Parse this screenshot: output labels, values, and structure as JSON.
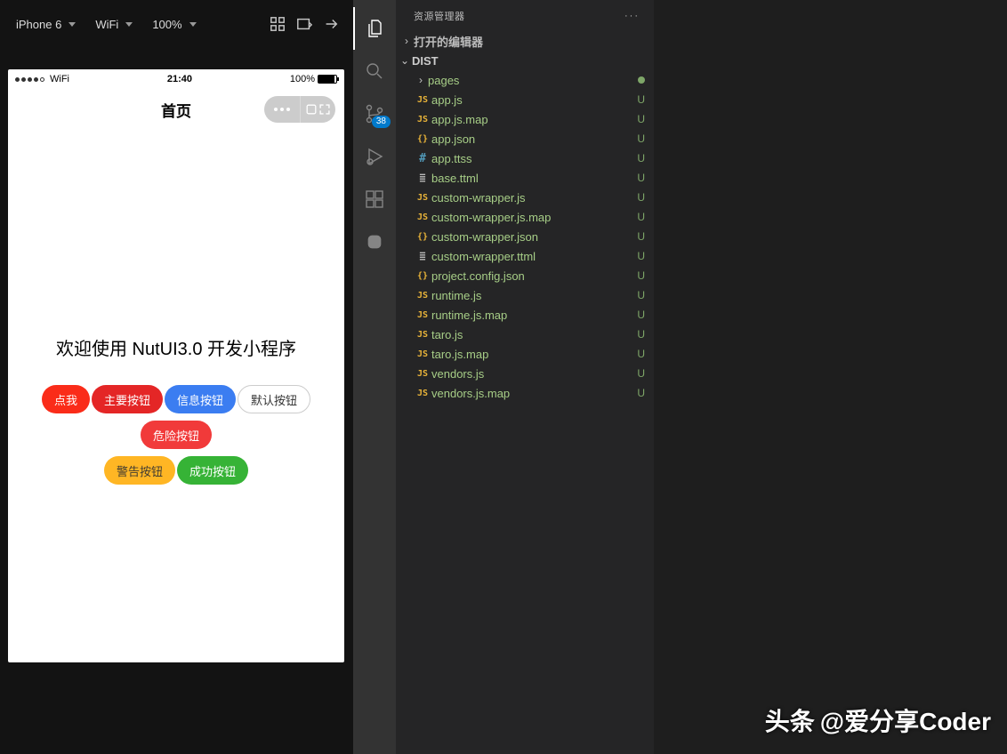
{
  "simulator": {
    "top_menu": [
      "",
      "",
      "",
      "",
      "",
      ""
    ],
    "toolbar": {
      "device": "iPhone 6",
      "network": "WiFi",
      "scale": "100%"
    },
    "status": {
      "carrier": "WiFi",
      "time": "21:40",
      "battery": "100%"
    },
    "nav_title": "首页",
    "welcome": "欢迎使用 NutUI3.0 开发小程序",
    "buttons": [
      {
        "label": "点我",
        "cls": "b1"
      },
      {
        "label": "主要按钮",
        "cls": "b2"
      },
      {
        "label": "信息按钮",
        "cls": "b3"
      },
      {
        "label": "默认按钮",
        "cls": "b4"
      },
      {
        "label": "危险按钮",
        "cls": "b5"
      },
      {
        "label": "警告按钮",
        "cls": "b6"
      },
      {
        "label": "成功按钮",
        "cls": "b7"
      }
    ]
  },
  "vscode": {
    "panel_title": "资源管理器",
    "activity_badge": "38",
    "sections": {
      "open_editors": "打开的编辑器",
      "root": "DIST"
    },
    "files": [
      {
        "type": "folder",
        "name": "pages",
        "depth": 1,
        "status": "dot"
      },
      {
        "type": "js",
        "name": "app.js",
        "depth": 1,
        "status": "U"
      },
      {
        "type": "js",
        "name": "app.js.map",
        "depth": 1,
        "status": "U"
      },
      {
        "type": "json",
        "name": "app.json",
        "depth": 1,
        "status": "U"
      },
      {
        "type": "hash",
        "name": "app.ttss",
        "depth": 1,
        "status": "U"
      },
      {
        "type": "ttml",
        "name": "base.ttml",
        "depth": 1,
        "status": "U"
      },
      {
        "type": "js",
        "name": "custom-wrapper.js",
        "depth": 1,
        "status": "U"
      },
      {
        "type": "js",
        "name": "custom-wrapper.js.map",
        "depth": 1,
        "status": "U"
      },
      {
        "type": "json",
        "name": "custom-wrapper.json",
        "depth": 1,
        "status": "U"
      },
      {
        "type": "ttml",
        "name": "custom-wrapper.ttml",
        "depth": 1,
        "status": "U"
      },
      {
        "type": "json",
        "name": "project.config.json",
        "depth": 1,
        "status": "U"
      },
      {
        "type": "js",
        "name": "runtime.js",
        "depth": 1,
        "status": "U"
      },
      {
        "type": "js",
        "name": "runtime.js.map",
        "depth": 1,
        "status": "U"
      },
      {
        "type": "js",
        "name": "taro.js",
        "depth": 1,
        "status": "U"
      },
      {
        "type": "js",
        "name": "taro.js.map",
        "depth": 1,
        "status": "U"
      },
      {
        "type": "js",
        "name": "vendors.js",
        "depth": 1,
        "status": "U"
      },
      {
        "type": "js",
        "name": "vendors.js.map",
        "depth": 1,
        "status": "U"
      }
    ]
  },
  "watermark": {
    "prefix": "头条",
    "handle": "@爱分享Coder"
  }
}
